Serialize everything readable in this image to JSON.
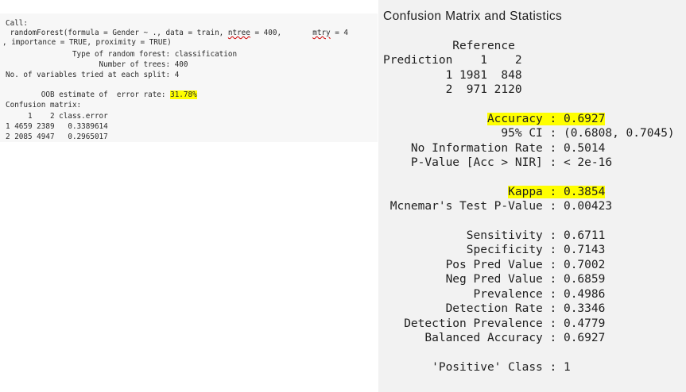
{
  "rf_output": {
    "call_label": "Call:",
    "call_line1_a": " randomForest(formula = Gender ~ ., data = train, ",
    "ntree_word": "ntree",
    "call_line1_b": " = 400,       ",
    "mtry_word": "mtry",
    "call_line1_c": " = 4",
    "call_line2": ", importance = TRUE, proximity = TRUE)",
    "type_line": "               Type of random forest: classification",
    "trees_line": "                     Number of trees: 400",
    "vars_line": "No. of variables tried at each split: 4",
    "oob_label": "        OOB estimate of  error rate: ",
    "oob_value": "31.78%",
    "cm_label": "Confusion matrix:",
    "cm_header": "     1    2 class.error",
    "cm_row1": "1 4659 2389   0.3389614",
    "cm_row2": "2 2085 4947   0.2965017"
  },
  "caret_output": {
    "title": "Confusion Matrix and Statistics",
    "reference_label": "          Reference",
    "prediction_header": "Prediction    1    2",
    "row1": "         1 1981  848",
    "row2": "         2  971 2120",
    "accuracy": "Accuracy : 0.6927",
    "accuracy_indent": "               ",
    "ci_line": "                 95% CI : (0.6808, 0.7045)",
    "nir_line": "    No Information Rate : 0.5014",
    "pvalue_line": "    P-Value [Acc > NIR] : < 2e-16",
    "kappa": "Kappa : 0.3854",
    "kappa_indent": "                  ",
    "mcnemar_line": " Mcnemar's Test P-Value : 0.00423",
    "sensitivity_line": "            Sensitivity : 0.6711",
    "specificity_line": "            Specificity : 0.7143",
    "pos_pred_line": "         Pos Pred Value : 0.7002",
    "neg_pred_line": "         Neg Pred Value : 0.6859",
    "prevalence_line": "             Prevalence : 0.4986",
    "detection_rate_line": "         Detection Rate : 0.3346",
    "detection_prev_line": "   Detection Prevalence : 0.4779",
    "balanced_acc_line": "      Balanced Accuracy : 0.6927",
    "positive_class_line": "       'Positive' Class : 1"
  },
  "colors": {
    "highlight": "#ffff00",
    "spellcheck_underline": "#d00000"
  }
}
